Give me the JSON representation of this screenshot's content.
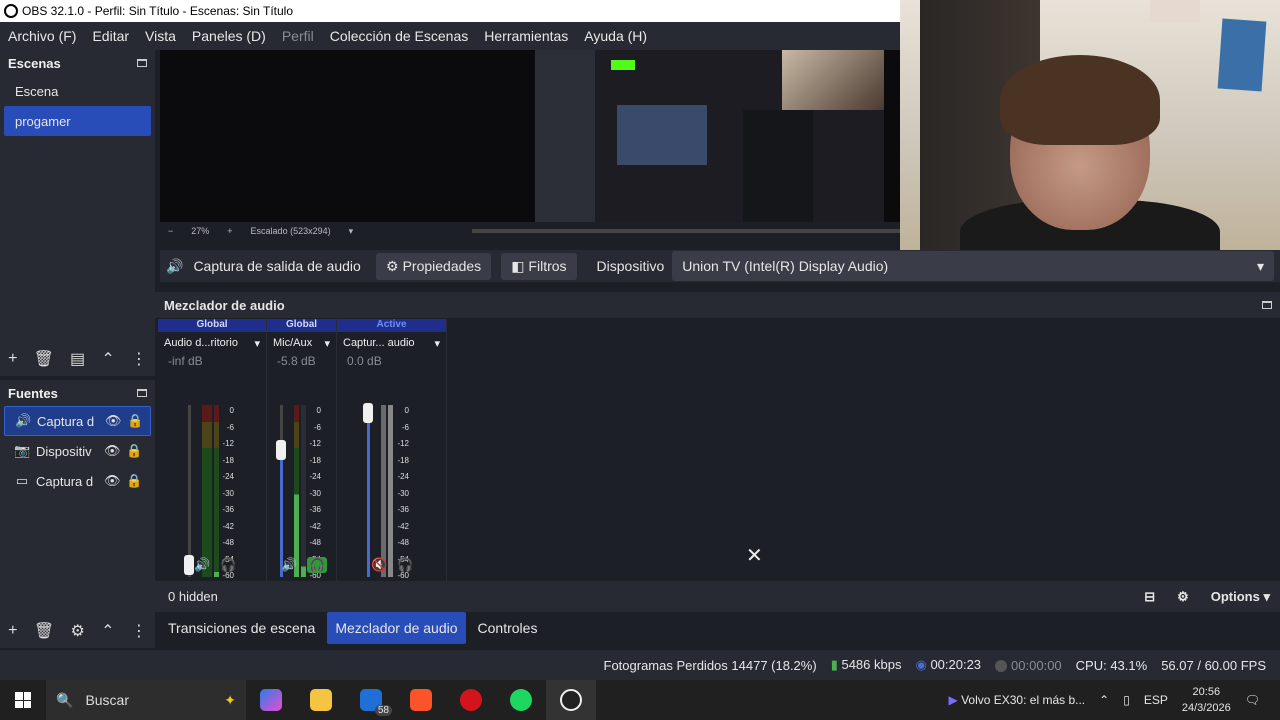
{
  "window": {
    "title": "OBS 32.1.0 - Perfil: Sin Título - Escenas: Sin Título"
  },
  "menu": [
    "Archivo (F)",
    "Editar",
    "Vista",
    "Paneles (D)",
    "Perfil",
    "Colección de Escenas",
    "Herramientas",
    "Ayuda (H)"
  ],
  "scenes": {
    "title": "Escenas",
    "items": [
      "Escena",
      "progamer"
    ]
  },
  "sources": {
    "title": "Fuentes",
    "items": [
      "Captura d",
      "Dispositiv",
      "Captura d"
    ]
  },
  "preview": {
    "zoom": "27%",
    "scale": "Escalado (523x294)"
  },
  "source_toolbar": {
    "source_name": "Captura de salida de audio",
    "properties": "Propiedades",
    "filters": "Filtros",
    "device_label": "Dispositivo",
    "device_value": "Union TV (Intel(R) Display Audio)"
  },
  "mixer": {
    "title": "Mezclador de audio",
    "channels": [
      {
        "badge": "Global",
        "name": "Audio d...ritorio",
        "db": "-inf dB"
      },
      {
        "badge": "Global",
        "name": "Mic/Aux",
        "db": "-5.8 dB"
      },
      {
        "badge": "Active",
        "name": "Captur... audio",
        "db": "0.0 dB"
      }
    ],
    "scale": [
      "0",
      "-6",
      "-12",
      "-18",
      "-24",
      "-30",
      "-36",
      "-42",
      "-48",
      "-54",
      "-60"
    ],
    "hidden": "0 hidden",
    "options": "Options"
  },
  "tabs": [
    "Transiciones de escena",
    "Mezclador de audio",
    "Controles"
  ],
  "status": {
    "dropped": "Fotogramas Perdidos 14477 (18.2%)",
    "bitrate": "5486 kbps",
    "stream_time": "00:20:23",
    "rec_time": "00:00:00",
    "cpu": "CPU: 43.1%",
    "fps": "56.07 / 60.00 FPS"
  },
  "taskbar": {
    "search": "Buscar",
    "mail_badge": "58",
    "media": "Volvo EX30: el más b...",
    "lang": "ESP",
    "time": "20:56",
    "date": "24/3/2026"
  }
}
